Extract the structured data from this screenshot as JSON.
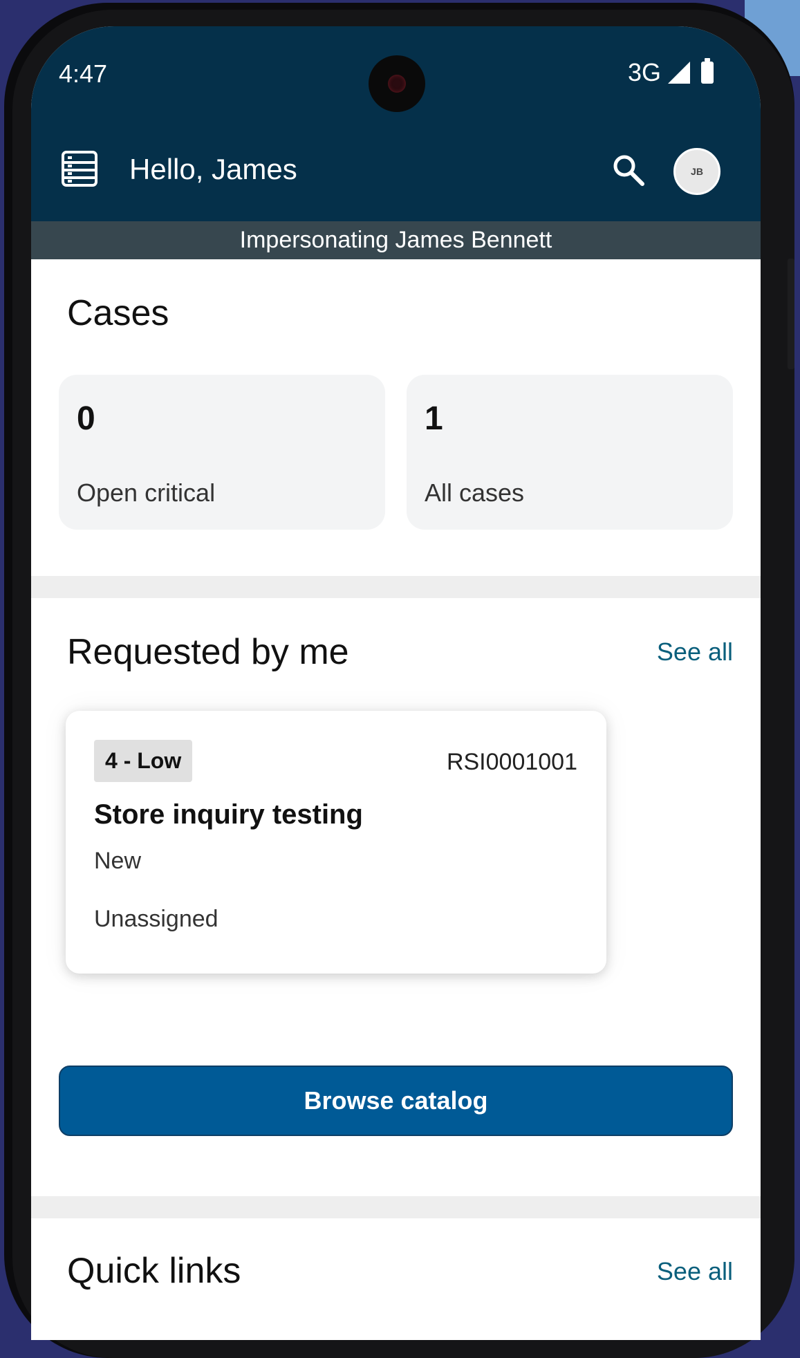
{
  "status_bar": {
    "time": "4:47",
    "network": "3G"
  },
  "header": {
    "greeting": "Hello, James",
    "avatar_initials": "JB"
  },
  "banner": {
    "text": "Impersonating James Bennett"
  },
  "cases": {
    "title": "Cases",
    "stats": [
      {
        "value": "0",
        "label": "Open critical"
      },
      {
        "value": "1",
        "label": "All cases"
      }
    ]
  },
  "requested": {
    "title": "Requested by me",
    "see_all": "See all",
    "card": {
      "priority": "4 - Low",
      "number": "RSI0001001",
      "title": "Store inquiry testing",
      "state": "New",
      "assignee": "Unassigned"
    }
  },
  "browse_catalog": "Browse catalog",
  "quick_links": {
    "title": "Quick links",
    "see_all": "See all"
  },
  "colors": {
    "header": "#05304a",
    "banner": "#37474f",
    "primary_button": "#005a96",
    "link": "#0a5f7c"
  }
}
